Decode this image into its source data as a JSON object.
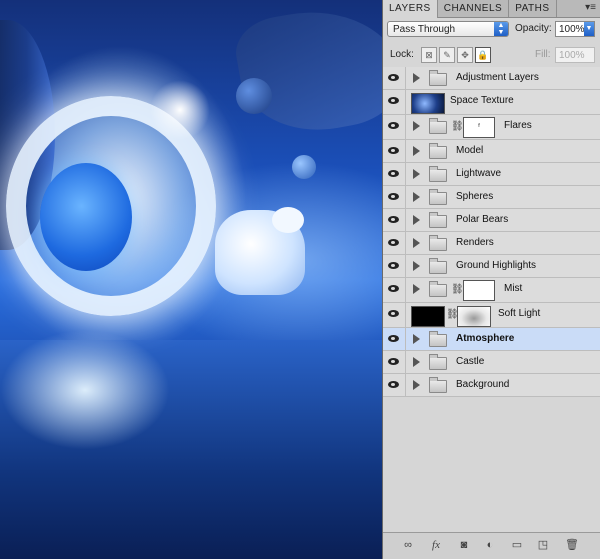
{
  "panel": {
    "tabs": [
      {
        "label": "LAYERS"
      },
      {
        "label": "CHANNELS"
      },
      {
        "label": "PATHS"
      }
    ],
    "menu_glyph": "▾≡",
    "blend_mode": "Pass Through",
    "opacity_label": "Opacity:",
    "opacity_value": "100%",
    "lock_label": "Lock:",
    "fill_label": "Fill:",
    "fill_value": "100%",
    "layers": [
      {
        "name": "Adjustment Layers",
        "kind": "group"
      },
      {
        "name": "Space Texture",
        "kind": "image"
      },
      {
        "name": "Flares",
        "kind": "group-mask"
      },
      {
        "name": "Model",
        "kind": "group"
      },
      {
        "name": "Lightwave",
        "kind": "group"
      },
      {
        "name": "Spheres",
        "kind": "group"
      },
      {
        "name": "Polar Bears",
        "kind": "group"
      },
      {
        "name": "Renders",
        "kind": "group"
      },
      {
        "name": "Ground Highlights",
        "kind": "group"
      },
      {
        "name": "Mist",
        "kind": "group-mask"
      },
      {
        "name": "Soft Light",
        "kind": "image-mask"
      },
      {
        "name": "Atmosphere",
        "kind": "group",
        "selected": true
      },
      {
        "name": "Castle",
        "kind": "group"
      },
      {
        "name": "Background",
        "kind": "group"
      }
    ],
    "footer_icons": [
      "link-icon",
      "fx-icon",
      "add-mask-icon",
      "adjustment-icon",
      "new-group-icon",
      "new-layer-icon",
      "trash-icon"
    ]
  }
}
